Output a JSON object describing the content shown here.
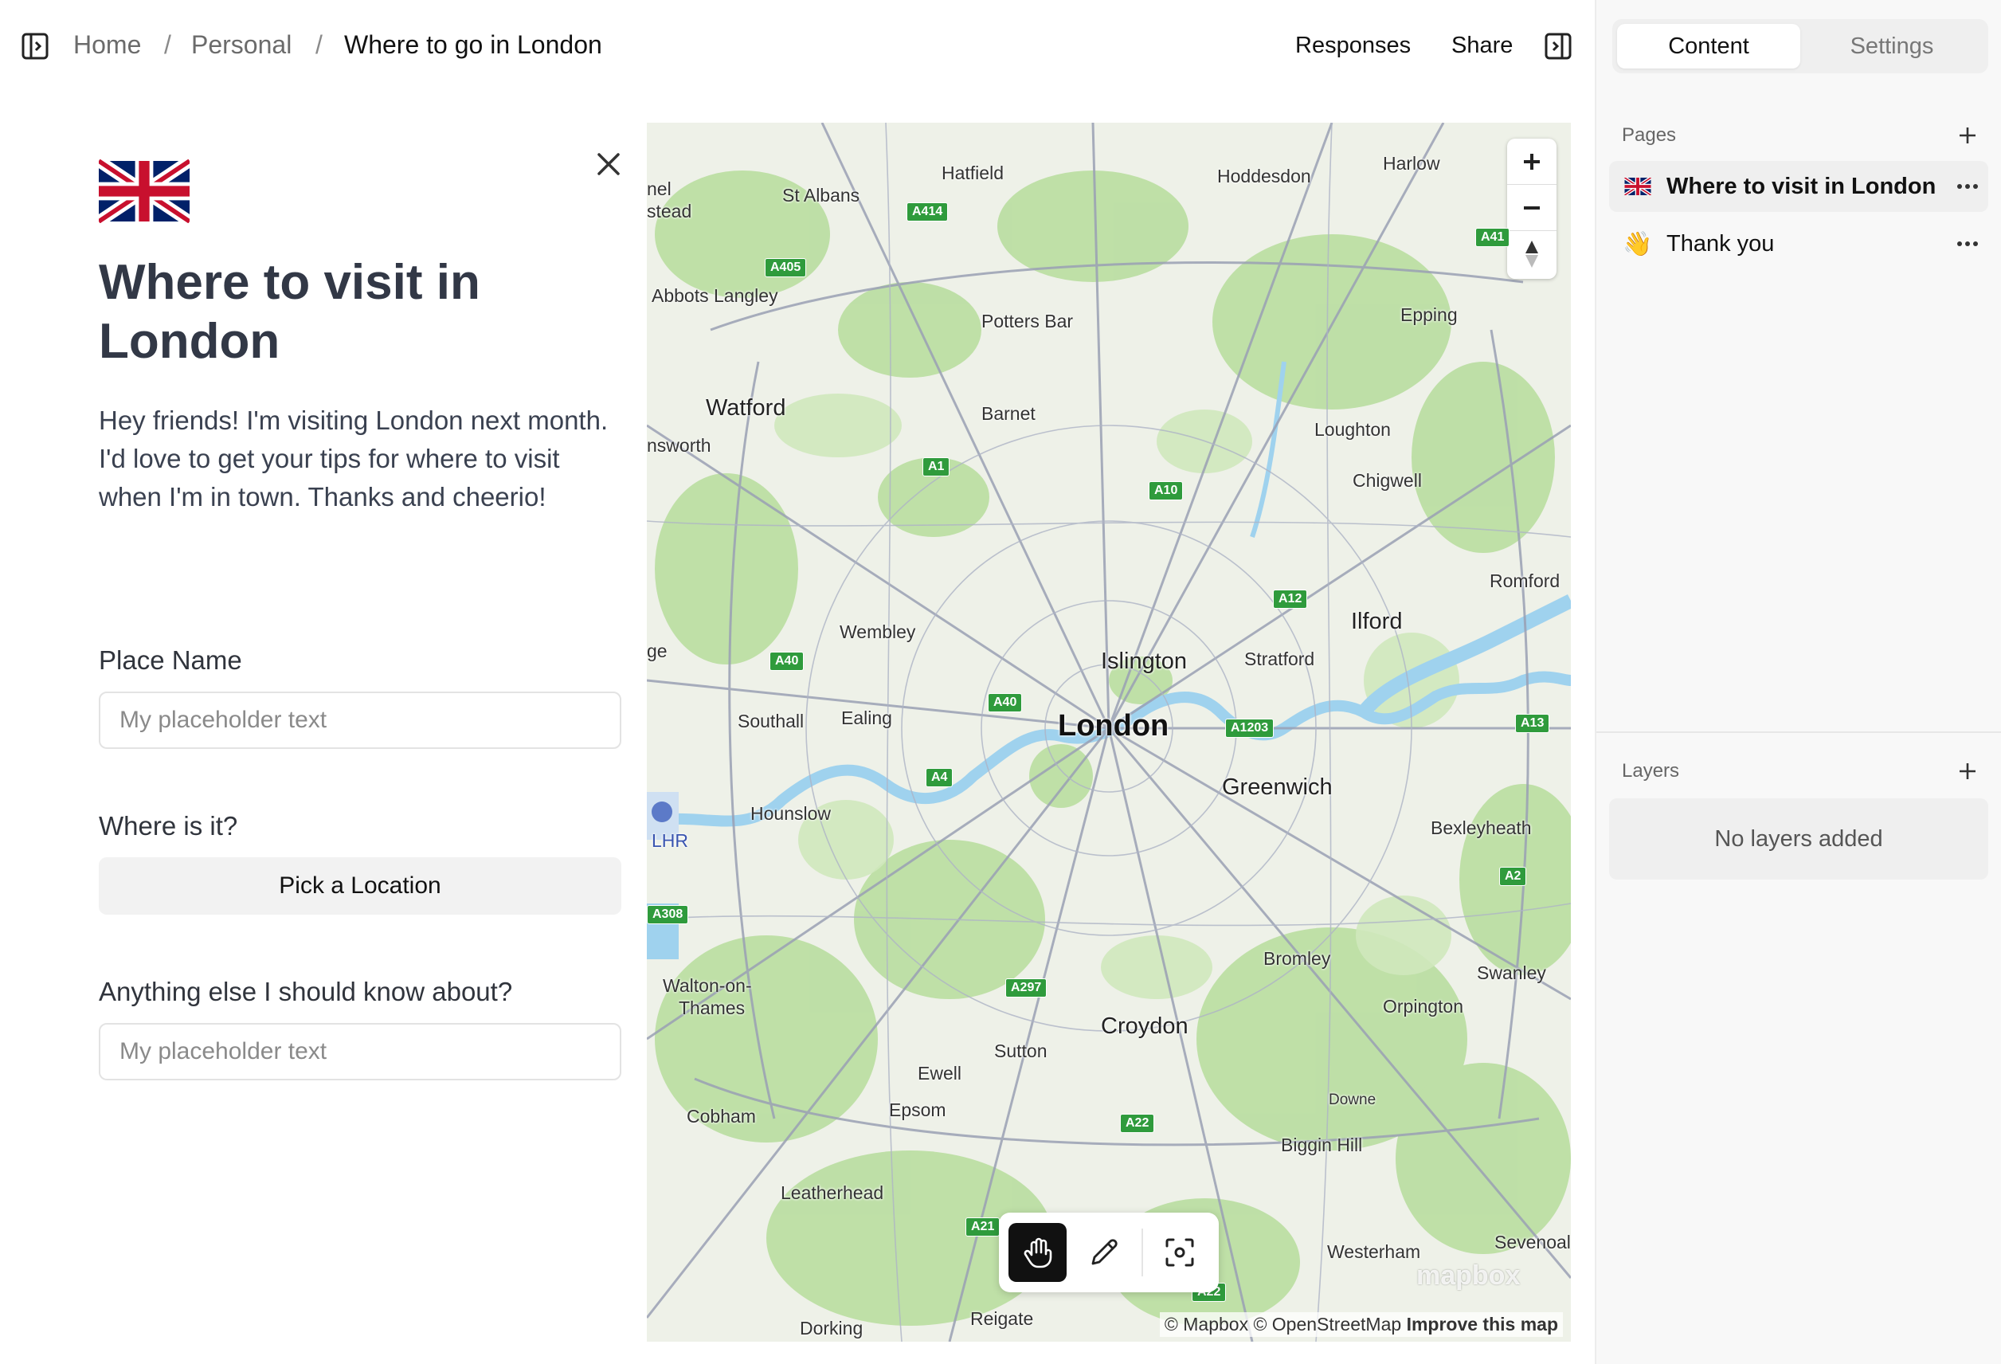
{
  "breadcrumb": {
    "items": [
      "Home",
      "Personal",
      "Where to go in London"
    ],
    "separator": "/"
  },
  "header": {
    "responses_label": "Responses",
    "share_label": "Share"
  },
  "form": {
    "flag_icon": "uk-flag-icon",
    "title": "Where to visit in London",
    "description": "Hey friends! I'm visiting London next month. I'd love to get your tips for where to visit when I'm in town. Thanks and cheerio!",
    "fields": {
      "place_name_label": "Place Name",
      "place_name_placeholder": "My placeholder text",
      "where_label": "Where is it?",
      "pick_location_label": "Pick a Location",
      "anything_else_label": "Anything else I should know about?",
      "anything_else_placeholder": "My placeholder text"
    }
  },
  "map": {
    "places": {
      "london": "London",
      "islington": "Islington",
      "stratford": "Stratford",
      "greenwich": "Greenwich",
      "ilford": "Ilford",
      "croydon": "Croydon",
      "watford": "Watford",
      "wembley": "Wembley",
      "ealing": "Ealing",
      "southall": "Southall",
      "hounslow": "Hounslow",
      "barnet": "Barnet",
      "potters_bar": "Potters Bar",
      "st_albans": "St Albans",
      "hatfield": "Hatfield",
      "hoddesdon": "Hoddesdon",
      "harlow": "Harlow",
      "epping": "Epping",
      "loughton": "Loughton",
      "chigwell": "Chigwell",
      "romford": "Romford",
      "abbots_langley": "Abbots Langley",
      "bexleyheath": "Bexleyheath",
      "bromley": "Bromley",
      "swanley": "Swanley",
      "orpington": "Orpington",
      "sutton": "Sutton",
      "ewell": "Ewell",
      "epsom": "Epsom",
      "cobham": "Cobham",
      "walton": "Walton-on-",
      "thames": "Thames",
      "downe": "Downe",
      "biggin_hill": "Biggin Hill",
      "leatherhead": "Leatherhead",
      "westerham": "Westerham",
      "sevenoaks": "Sevenoal",
      "dorking": "Dorking",
      "reigate": "Reigate",
      "hemel": "nel",
      "hemel2": "stead",
      "rickmansworth": "nsworth",
      "ge": "ge",
      "lhr": "LHR"
    },
    "roads": {
      "a414": "A414",
      "a405": "A405",
      "a41": "A41",
      "a1": "A1",
      "a10": "A10",
      "a12": "A12",
      "a40a": "A40",
      "a40b": "A40",
      "a1203": "A1203",
      "a13": "A13",
      "a4": "A4",
      "a2": "A2",
      "a308": "A308",
      "a297": "A297",
      "a22": "A22",
      "a21": "A21",
      "a22b": "A22"
    },
    "attribution": "© Mapbox © OpenStreetMap",
    "improve_label": "Improve this map",
    "logo_text": "mapbox",
    "zoom_in_icon": "plus-icon",
    "zoom_out_icon": "minus-icon",
    "compass_icon": "compass-icon"
  },
  "map_toolbar": {
    "pan_icon": "hand-icon",
    "draw_icon": "pencil-icon",
    "locate_icon": "focus-icon"
  },
  "panel": {
    "tabs": [
      "Content",
      "Settings"
    ],
    "pages_title": "Pages",
    "pages": [
      {
        "emoji": "uk-flag-icon",
        "label": "Where to visit in London"
      },
      {
        "emoji": "👋",
        "label": "Thank you"
      }
    ],
    "layers_title": "Layers",
    "layers_empty": "No layers added"
  }
}
